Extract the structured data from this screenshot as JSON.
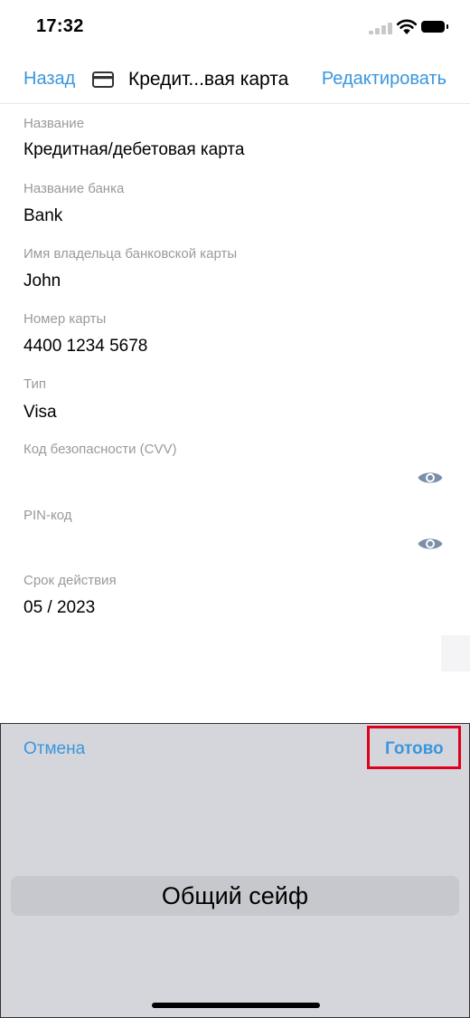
{
  "status_bar": {
    "time": "17:32"
  },
  "nav": {
    "back_label": "Назад",
    "title": "Кредит...вая карта",
    "edit_label": "Редактировать"
  },
  "fields": [
    {
      "label": "Название",
      "value": "Кредитная/дебетовая карта"
    },
    {
      "label": "Название банка",
      "value": "Bank"
    },
    {
      "label": "Имя владельца банковской карты",
      "value": "John"
    },
    {
      "label": "Номер карты",
      "value": "4400 1234 5678"
    },
    {
      "label": "Тип",
      "value": "Visa"
    },
    {
      "label": "Код безопасности (CVV)",
      "value": ""
    },
    {
      "label": "PIN-код",
      "value": ""
    },
    {
      "label": "Срок действия",
      "value": "05 / 2023"
    }
  ],
  "picker": {
    "cancel_label": "Отмена",
    "done_label": "Готово",
    "selected_option": "Общий сейф"
  },
  "colors": {
    "accent": "#3a96dd",
    "label_gray": "#9a9a9f",
    "picker_bg": "#d4d6dc",
    "highlight_red": "#e0001b",
    "eye_icon": "#7b8fa8"
  }
}
